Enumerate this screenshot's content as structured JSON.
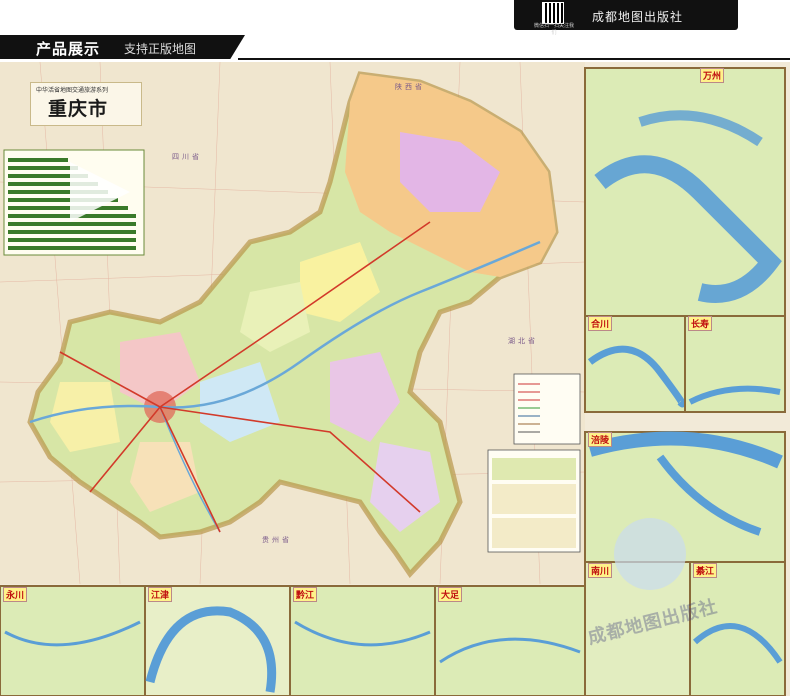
{
  "header": {
    "publisher": "成都地图出版社",
    "qr_caption": "微信扫一扫关注我们",
    "section_title": "产品展示",
    "section_subtitle": "支持正版地图"
  },
  "map": {
    "series": "中华活省地图交通旅游系列",
    "city_title": "重庆市",
    "provinces": [
      "四川省",
      "陕西省",
      "湖北省",
      "贵州省"
    ],
    "accent": "#b8954a",
    "water": "#6aa8d8"
  },
  "insets_right": [
    {
      "label": "万州"
    },
    {
      "label": "合川"
    },
    {
      "label": "长寿"
    },
    {
      "label": "涪陵"
    },
    {
      "label": "南川"
    },
    {
      "label": "綦江"
    }
  ],
  "insets_bottom": [
    {
      "label": "永川"
    },
    {
      "label": "江津"
    },
    {
      "label": "黔江"
    },
    {
      "label": "大足"
    }
  ],
  "watermark": "成都地图出版社"
}
